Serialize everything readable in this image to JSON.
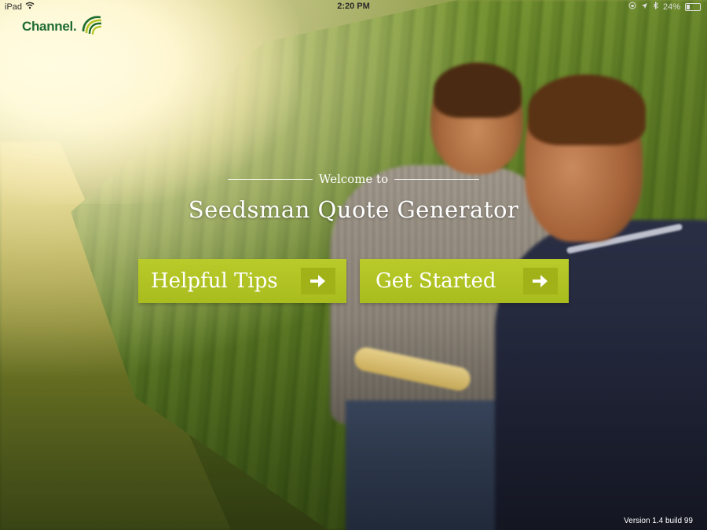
{
  "status_bar": {
    "device": "iPad",
    "time": "2:20 PM",
    "battery_percent": "24%",
    "battery_level": 0.24
  },
  "logo": {
    "text": "Channel",
    "brand_color": "#1e6b2e",
    "icon": "channel-swirl-icon"
  },
  "welcome": {
    "intro": "Welcome to",
    "title": "Seedsman Quote Generator"
  },
  "buttons": {
    "helpful_tips": {
      "label": "Helpful Tips",
      "icon": "arrow-right-icon"
    },
    "get_started": {
      "label": "Get Started",
      "icon": "arrow-right-icon"
    },
    "accent_color": "#b3c525"
  },
  "footer": {
    "version": "Version 1.4  build 99"
  }
}
